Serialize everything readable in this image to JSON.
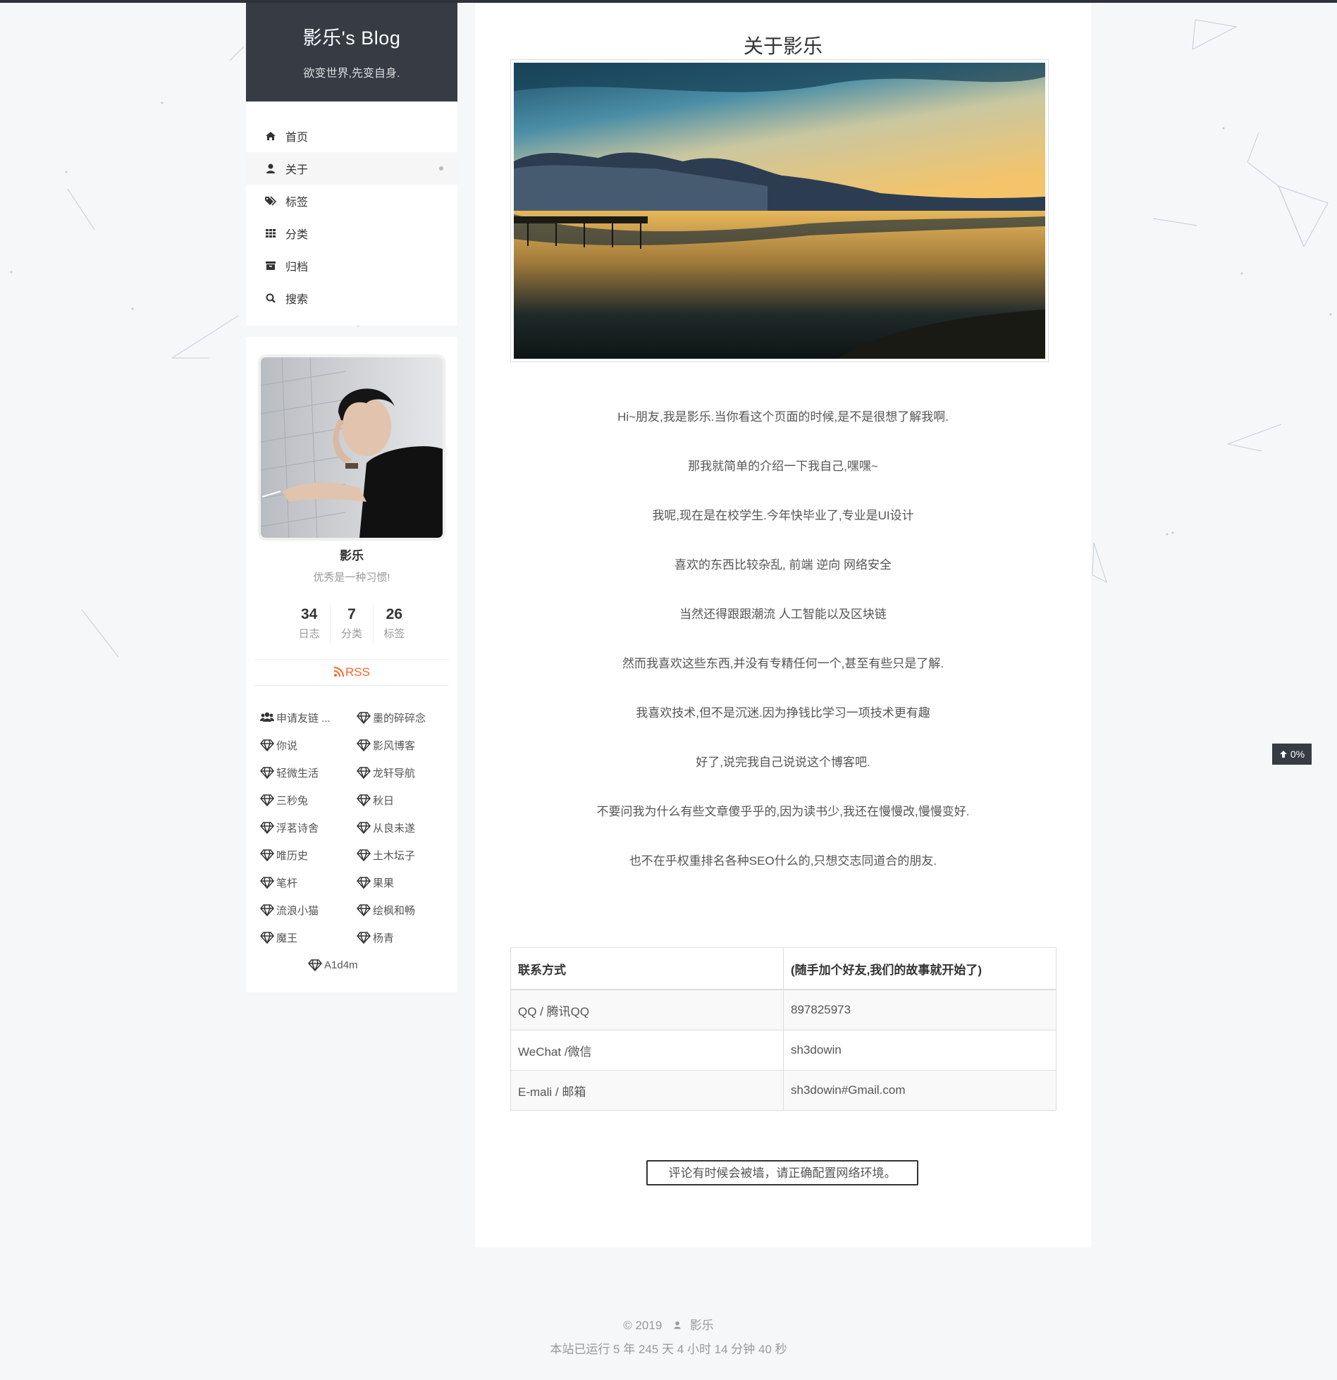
{
  "site": {
    "title": "影乐's Blog",
    "subtitle": "欲变世界,先变自身."
  },
  "menu": {
    "items": [
      {
        "label": "首页",
        "icon": "home-icon"
      },
      {
        "label": "关于",
        "icon": "user-icon",
        "active": true
      },
      {
        "label": "标签",
        "icon": "tags-icon"
      },
      {
        "label": "分类",
        "icon": "th-icon"
      },
      {
        "label": "归档",
        "icon": "archive-icon"
      },
      {
        "label": "搜索",
        "icon": "search-icon"
      }
    ]
  },
  "profile": {
    "name": "影乐",
    "motto": "优秀是一种习惯!",
    "stats": [
      {
        "value": "34",
        "label": "日志"
      },
      {
        "value": "7",
        "label": "分类"
      },
      {
        "value": "26",
        "label": "标签"
      }
    ],
    "rss": "RSS",
    "links": [
      {
        "label": "申请友链 ...",
        "icon": "users-icon"
      },
      {
        "label": "墨的碎碎念",
        "icon": "diamond-icon"
      },
      {
        "label": "你说",
        "icon": "diamond-icon"
      },
      {
        "label": "影风博客",
        "icon": "diamond-icon"
      },
      {
        "label": "轻微生活",
        "icon": "diamond-icon"
      },
      {
        "label": "龙轩导航",
        "icon": "diamond-icon"
      },
      {
        "label": "三秒兔",
        "icon": "diamond-icon"
      },
      {
        "label": "秋日",
        "icon": "diamond-icon"
      },
      {
        "label": "浮茗诗舍",
        "icon": "diamond-icon"
      },
      {
        "label": "从良未遂",
        "icon": "diamond-icon"
      },
      {
        "label": "唯历史",
        "icon": "diamond-icon"
      },
      {
        "label": "土木坛子",
        "icon": "diamond-icon"
      },
      {
        "label": "笔杆",
        "icon": "diamond-icon"
      },
      {
        "label": "果果",
        "icon": "diamond-icon"
      },
      {
        "label": "流浪小猫",
        "icon": "diamond-icon"
      },
      {
        "label": "绘枫和畅",
        "icon": "diamond-icon"
      },
      {
        "label": "魔王",
        "icon": "diamond-icon"
      },
      {
        "label": "杨青",
        "icon": "diamond-icon"
      },
      {
        "label": "A1d4m",
        "icon": "diamond-icon"
      }
    ]
  },
  "post": {
    "title": "关于影乐",
    "paragraphs": [
      "Hi~朋友,我是影乐.当你看这个页面的时候,是不是很想了解我啊.",
      "那我就简单的介绍一下我自己,嘿嘿~",
      "我呢,现在是在校学生.今年快毕业了,专业是UI设计",
      "喜欢的东西比较杂乱, 前端 逆向 网络安全",
      "当然还得跟跟潮流 人工智能以及区块链",
      "然而我喜欢这些东西,并没有专精任何一个,甚至有些只是了解.",
      "我喜欢技术,但不是沉迷.因为挣钱比学习一项技术更有趣",
      "好了,说完我自己说说这个博客吧.",
      "不要问我为什么有些文章傻乎乎的,因为读书少,我还在慢慢改,慢慢变好.",
      "也不在乎权重排名各种SEO什么的,只想交志同道合的朋友."
    ],
    "contact_table": {
      "headers": [
        "联系方式",
        "(随手加个好友,我们的故事就开始了)"
      ],
      "rows": [
        [
          "QQ / 腾讯QQ",
          "897825973"
        ],
        [
          "WeChat /微信",
          "sh3dowin"
        ],
        [
          "E-mali / 邮箱",
          "sh3dowin#Gmail.com"
        ]
      ]
    },
    "comment_notice": "评论有时候会被墙，请正确配置网络环境。"
  },
  "footer": {
    "copyright": "© 2019",
    "author": "影乐",
    "runtime": "本站已运行 5 年 245 天 4 小时 14 分钟 40 秒"
  },
  "back_to_top": {
    "percent": "0%"
  }
}
